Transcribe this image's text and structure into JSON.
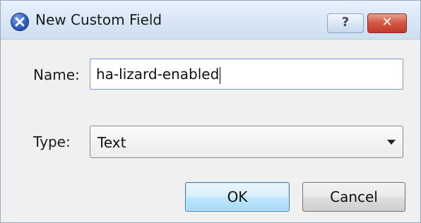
{
  "window": {
    "title": "New Custom Field",
    "help_label": "?",
    "close_label": "✕"
  },
  "form": {
    "name_label": "Name:",
    "name_value": "ha-lizard-enabled",
    "type_label": "Type:",
    "type_value": "Text"
  },
  "buttons": {
    "ok_label": "OK",
    "cancel_label": "Cancel"
  },
  "icons": {
    "app_icon": "x-app-icon",
    "dropdown_icon": "chevron-down-icon"
  },
  "colors": {
    "title_bar": "#dbe8f7",
    "close_button": "#c0392b",
    "ok_focus_border": "#3c7fb1"
  }
}
